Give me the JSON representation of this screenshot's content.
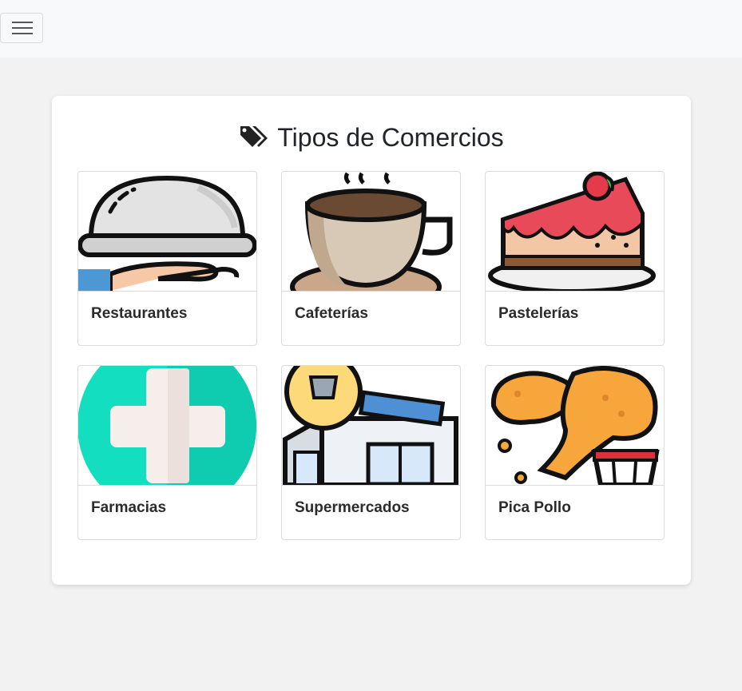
{
  "navbar": {
    "toggler_icon": "hamburger-menu-icon"
  },
  "heading": {
    "icon": "tags-icon",
    "title": "Tipos de Comercios"
  },
  "categories": [
    {
      "label": "Restaurantes",
      "icon": "serving-cloche-icon"
    },
    {
      "label": "Cafeterías",
      "icon": "coffee-cup-icon"
    },
    {
      "label": "Pastelerías",
      "icon": "cake-slice-icon"
    },
    {
      "label": "Farmacias",
      "icon": "medical-cross-icon"
    },
    {
      "label": "Supermercados",
      "icon": "supermarket-icon"
    },
    {
      "label": "Pica Pollo",
      "icon": "fried-chicken-icon"
    }
  ],
  "colors": {
    "background": "#f2f2f2",
    "navbar": "#f8f9fa",
    "panel": "#ffffff",
    "pharmacy_teal": "#13dfc0"
  }
}
